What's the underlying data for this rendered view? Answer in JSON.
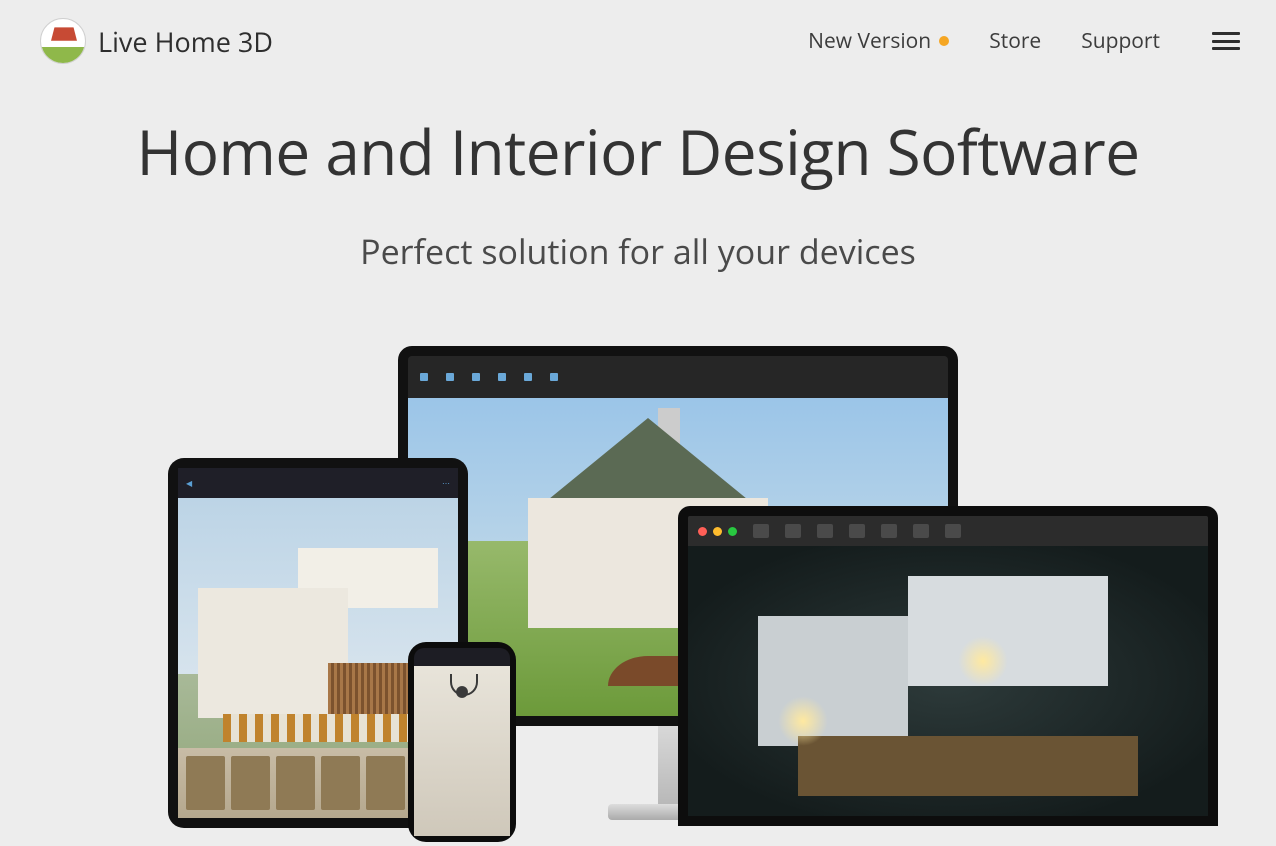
{
  "header": {
    "brand": "Live Home 3D",
    "nav": {
      "new_version": "New Version",
      "store": "Store",
      "support": "Support"
    }
  },
  "hero": {
    "title": "Home and Interior Design Software",
    "subtitle": "Perfect solution for all your devices"
  }
}
